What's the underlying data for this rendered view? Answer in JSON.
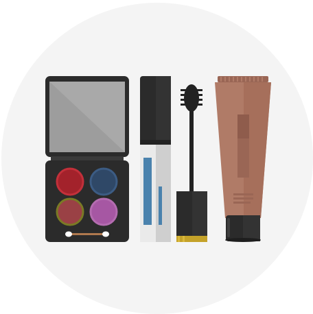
{
  "scene": {
    "background_color": "#ffffff",
    "circle_color": "#f4f4f4",
    "items": [
      {
        "name": "eyeshadow-palette",
        "icon": "eyeshadow-palette-icon",
        "case_color": "#2b2b2b",
        "mirror_color": "#a9a9a9",
        "shades": [
          "#a3222b",
          "#2f4867",
          "#9a4145",
          "#a657a3"
        ],
        "shade_ring_colors": [
          "#c3303a",
          "#3c5c84",
          "#7a7a25",
          "#b46cb0"
        ]
      },
      {
        "name": "liquid-eyeliner",
        "icon": "eyeliner-icon",
        "cap_color": "#2b2b2b",
        "tube_color": "#eaeaea",
        "accent_color": "#4a82ad"
      },
      {
        "name": "mascara-wand",
        "icon": "mascara-icon",
        "wand_color": "#222222",
        "base_color": "#2b2b2b",
        "band_color": "#c4a229"
      },
      {
        "name": "foundation-tube",
        "icon": "foundation-tube-icon",
        "tube_color": "#b07b67",
        "shade_color": "#9a6655",
        "cap_color": "#2b2b2b"
      }
    ]
  }
}
